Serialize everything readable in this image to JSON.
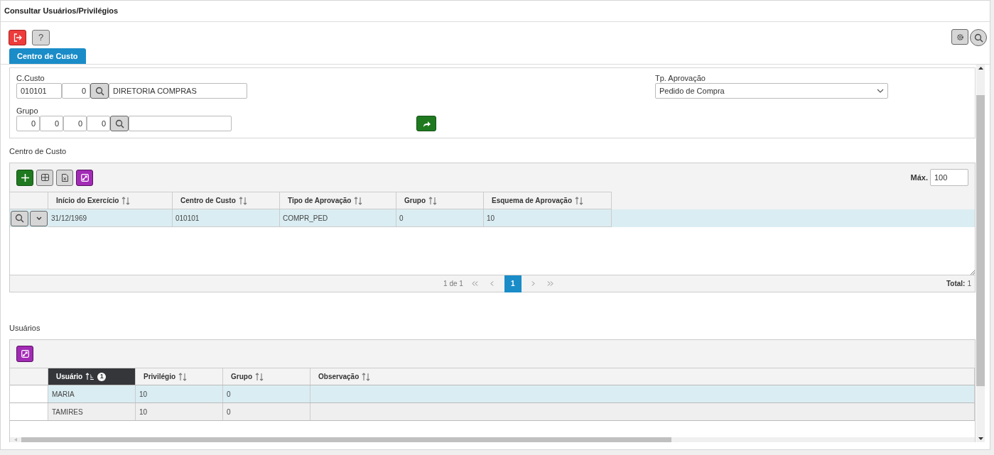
{
  "window": {
    "title": "Consultar Usuários/Privilégios"
  },
  "toolbar": {
    "help_label": "?"
  },
  "tabs": [
    {
      "label": "Centro de Custo",
      "selected": true
    }
  ],
  "filters": {
    "ccusto": {
      "label": "C.Custo",
      "values": [
        "010101",
        "0"
      ],
      "description": "DIRETORIA COMPRAS"
    },
    "grupo": {
      "label": "Grupo",
      "values": [
        "0",
        "0",
        "0",
        "0"
      ]
    },
    "tp_aprovacao": {
      "label": "Tp. Aprovação",
      "value": "Pedido de Compra"
    }
  },
  "cost_center_grid": {
    "title": "Centro de Custo",
    "max_label": "Máx.",
    "max_value": "100",
    "columns": [
      {
        "label": "Início do Exercício"
      },
      {
        "label": "Centro de Custo"
      },
      {
        "label": "Tipo de Aprovação"
      },
      {
        "label": "Grupo"
      },
      {
        "label": "Esquema de Aprovação"
      }
    ],
    "rows": [
      {
        "selected": true,
        "cells": [
          "31/12/1969",
          "010101",
          "COMPR_PED",
          "0",
          "10"
        ]
      }
    ],
    "page_info": "1 de 1",
    "pages": [
      {
        "label": "1",
        "selected": true
      }
    ],
    "total_label": "Total:",
    "total": "1"
  },
  "users_grid": {
    "title": "Usuários",
    "columns": [
      {
        "label": "Usuário",
        "sorted": true,
        "sort_order": "1"
      },
      {
        "label": "Privilégio",
        "sorted": false
      },
      {
        "label": "Grupo",
        "sorted": false
      },
      {
        "label": "Observação",
        "sorted": false
      }
    ],
    "rows": [
      {
        "selected": true,
        "cells": [
          "MARIA",
          "10",
          "0",
          ""
        ]
      },
      {
        "selected": false,
        "cells": [
          "TAMIRES",
          "10",
          "0",
          ""
        ]
      }
    ]
  }
}
